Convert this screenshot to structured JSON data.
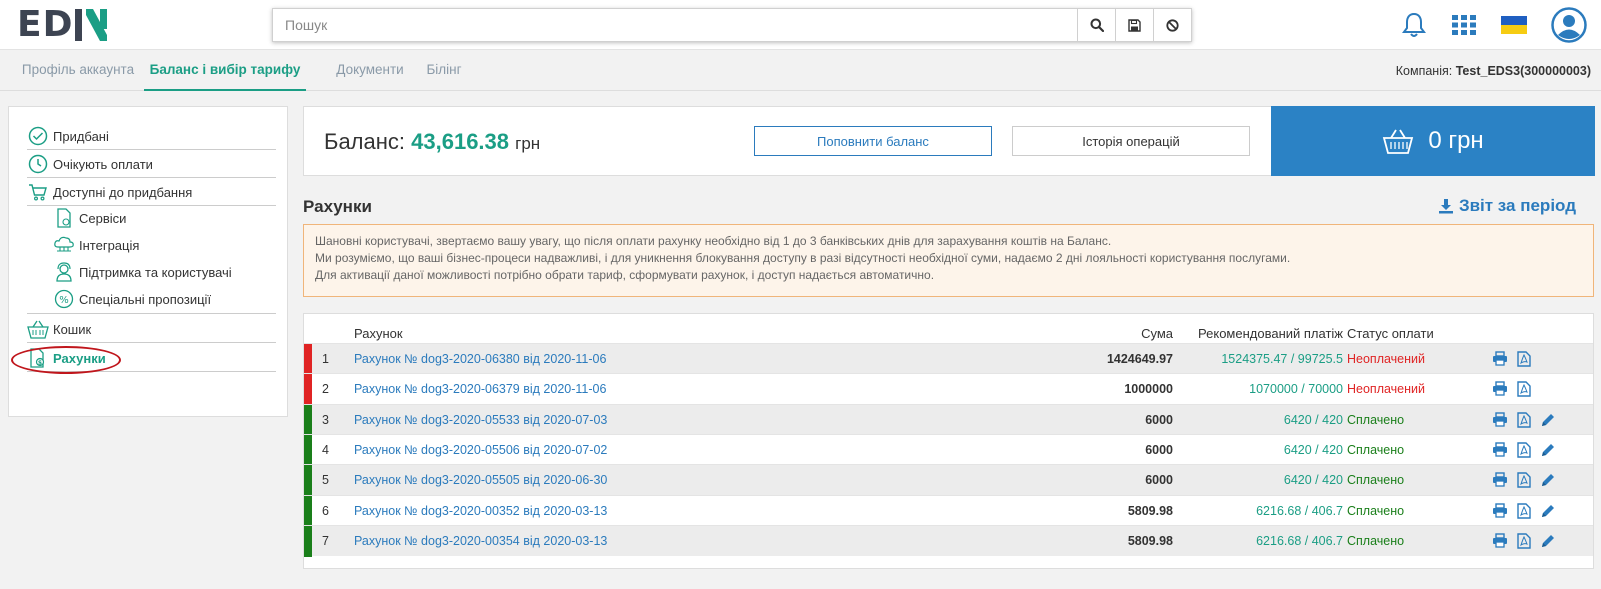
{
  "header": {
    "logo_left": "ED",
    "logo_right": "I",
    "search_placeholder": "Пошук"
  },
  "tabs": [
    {
      "label": "Профіль аккаунта"
    },
    {
      "label": "Баланс і вибір тарифу"
    },
    {
      "label": "Документи"
    },
    {
      "label": "Білінг"
    }
  ],
  "company": {
    "label": "Компанія:",
    "value": "Test_EDS3(300000003)"
  },
  "sidebar": {
    "items": [
      {
        "label": "Придбані"
      },
      {
        "label": "Очікують оплати"
      },
      {
        "label": "Доступні до придбання"
      },
      {
        "label": "Сервіси"
      },
      {
        "label": "Інтеграція"
      },
      {
        "label": "Підтримка та користувачі"
      },
      {
        "label": "Спеціальні пропозиції"
      },
      {
        "label": "Кошик"
      },
      {
        "label": "Рахунки"
      }
    ]
  },
  "balance": {
    "label": "Баланс:",
    "amount": "43,616.38",
    "currency": "грн",
    "topup_label": "Поповнити баланс",
    "history_label": "Історія операцій",
    "cart_total": "0 грн"
  },
  "invoices": {
    "title": "Рахунки",
    "report_label": "Звіт за період",
    "notice": [
      "Шановні користувачі, звертаємо вашу увагу, що після оплати рахунку необхідно від 1 до 3 банківських днів для зарахування коштів на Баланс.",
      "Ми розуміємо, що ваші бізнес-процеси надважливі, і для уникнення блокування доступу в разі відсутності необхідної суми, надаємо 2 дні лояльності користування послугами.",
      "Для активації даної можливості потрібно обрати тариф, сформувати рахунок, і доступ надається автоматично."
    ],
    "columns": {
      "invoice": "Рахунок",
      "sum": "Сума",
      "recommended": "Рекомендований платіж",
      "status": "Статус оплати"
    },
    "rows": [
      {
        "num": "1",
        "title": "Рахунок № dog3-2020-06380 від 2020-11-06",
        "sum": "1424649.97",
        "recommended": "1524375.47 / 99725.5",
        "status": "Неоплачений",
        "paid": false
      },
      {
        "num": "2",
        "title": "Рахунок № dog3-2020-06379 від 2020-11-06",
        "sum": "1000000",
        "recommended": "1070000 / 70000",
        "status": "Неоплачений",
        "paid": false
      },
      {
        "num": "3",
        "title": "Рахунок № dog3-2020-05533 від 2020-07-03",
        "sum": "6000",
        "recommended": "6420 / 420",
        "status": "Сплачено",
        "paid": true
      },
      {
        "num": "4",
        "title": "Рахунок № dog3-2020-05506 від 2020-07-02",
        "sum": "6000",
        "recommended": "6420 / 420",
        "status": "Сплачено",
        "paid": true
      },
      {
        "num": "5",
        "title": "Рахунок № dog3-2020-05505 від 2020-06-30",
        "sum": "6000",
        "recommended": "6420 / 420",
        "status": "Сплачено",
        "paid": true
      },
      {
        "num": "6",
        "title": "Рахунок № dog3-2020-00352 від 2020-03-13",
        "sum": "5809.98",
        "recommended": "6216.68 / 406.7",
        "status": "Сплачено",
        "paid": true
      },
      {
        "num": "7",
        "title": "Рахунок № dog3-2020-00354 від 2020-03-13",
        "sum": "5809.98",
        "recommended": "6216.68 / 406.7",
        "status": "Сплачено",
        "paid": true
      }
    ]
  },
  "colors": {
    "accent_green": "#1b9e85",
    "link_blue": "#2b7bbd",
    "unpaid_red": "#e02424",
    "paid_green": "#1a7f1a",
    "cart_blue": "#2b82c5"
  }
}
